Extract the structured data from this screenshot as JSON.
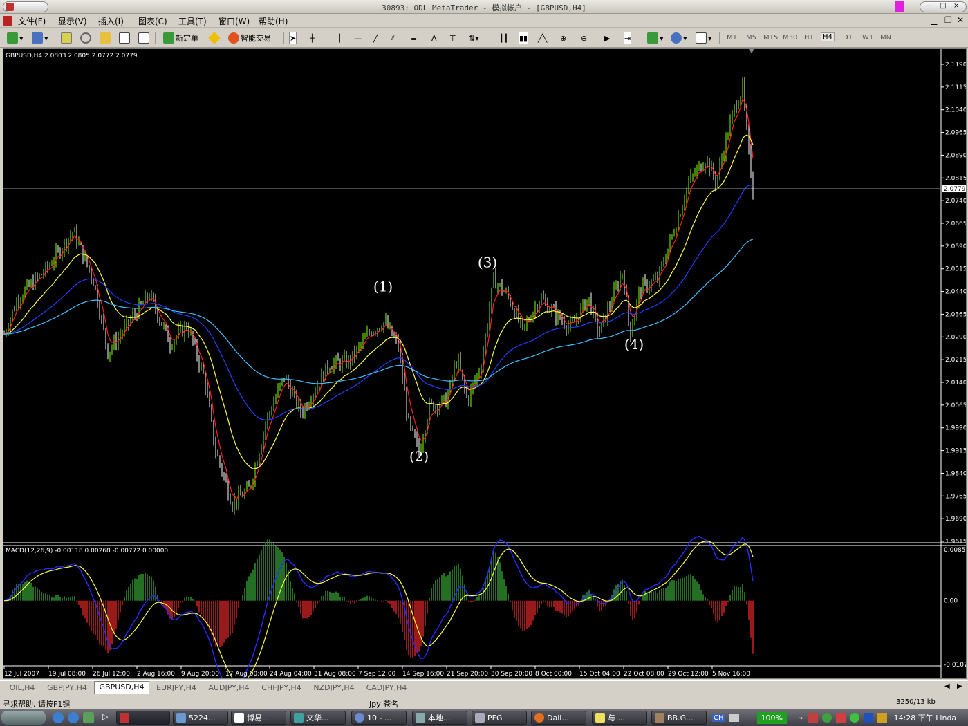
{
  "window": {
    "title": "30893: ODL MetaTrader - 模拟帐户 - [GBPUSD,H4]"
  },
  "menu": {
    "items": [
      "文件(F)",
      "显示(V)",
      "插入(I)",
      "图表(C)",
      "工具(T)",
      "窗口(W)",
      "帮助(H)"
    ]
  },
  "toolbar": {
    "new_order_label": "新定单",
    "expert_label": "智能交易",
    "timeframes": [
      "M1",
      "M5",
      "M15",
      "M30",
      "H1",
      "H4",
      "D1",
      "W1",
      "MN"
    ],
    "active_timeframe": "H4"
  },
  "chart": {
    "info": "GBPUSD,H4  2.0803 2.0805 2.0772 2.0779",
    "price_labels": [
      "2.1190",
      "2.1115",
      "2.1040",
      "2.0965",
      "2.0890",
      "2.0815",
      "2.0740",
      "2.0665",
      "2.0590",
      "2.0515",
      "2.0440",
      "2.0365",
      "2.0290",
      "2.0215",
      "2.0140",
      "2.0065",
      "1.9990",
      "1.9915",
      "1.9840",
      "1.9765",
      "1.9690",
      "1.9615"
    ],
    "current_price": "2.0779",
    "wave_labels": [
      "(1)",
      "(2)",
      "(3)",
      "(4)"
    ],
    "macd_info": "MACD(12,26,9) -0.00118 0.00268 -0.00772 0.00000",
    "macd_labels": [
      "0.00856",
      "0.00",
      "-0.01072"
    ],
    "time_labels": [
      "12 Jul 2007",
      "19 Jul 08:00",
      "26 Jul 12:00",
      "2 Aug 16:00",
      "9 Aug 20:00",
      "17 Aug 00:00",
      "24 Aug 04:00",
      "31 Aug 08:00",
      "7 Sep 12:00",
      "14 Sep 16:00",
      "21 Sep 20:00",
      "30 Sep 20:00",
      "8 Oct 00:00",
      "15 Oct 04:00",
      "22 Oct 08:00",
      "29 Oct 12:00",
      "5 Nov 16:00"
    ],
    "colors": {
      "background": "#000000",
      "bull": "#7fff00",
      "bear": "#ffffff",
      "ma_fast": "#ff2020",
      "ma_mid": "#ffff40",
      "ma_slow": "#2040ff",
      "ma_long": "#40c0ff",
      "macd_up": "#2e8b2e",
      "macd_down": "#c02020"
    }
  },
  "tabs": [
    "OIL,H4",
    "GBPJPY,H4",
    "GBPUSD,H4",
    "EURJPY,H4",
    "AUDJPY,H4",
    "CHFJPY,H4",
    "NZDJPY,H4",
    "CADJPY,H4"
  ],
  "active_tab": "GBPUSD,H4",
  "status": {
    "help": "寻求帮助, 请按F1键",
    "profile": "Jpy 苍名",
    "traffic": "3250/13 kb"
  },
  "taskbar": {
    "tasks": [
      "",
      "5224...",
      "博易...",
      "文华...",
      "10 - ...",
      "本地...",
      "PFG",
      "Dail...",
      "与 ...",
      "BB.G..."
    ],
    "zoom": "100%",
    "clock": "14:28 下午 Linda"
  }
}
